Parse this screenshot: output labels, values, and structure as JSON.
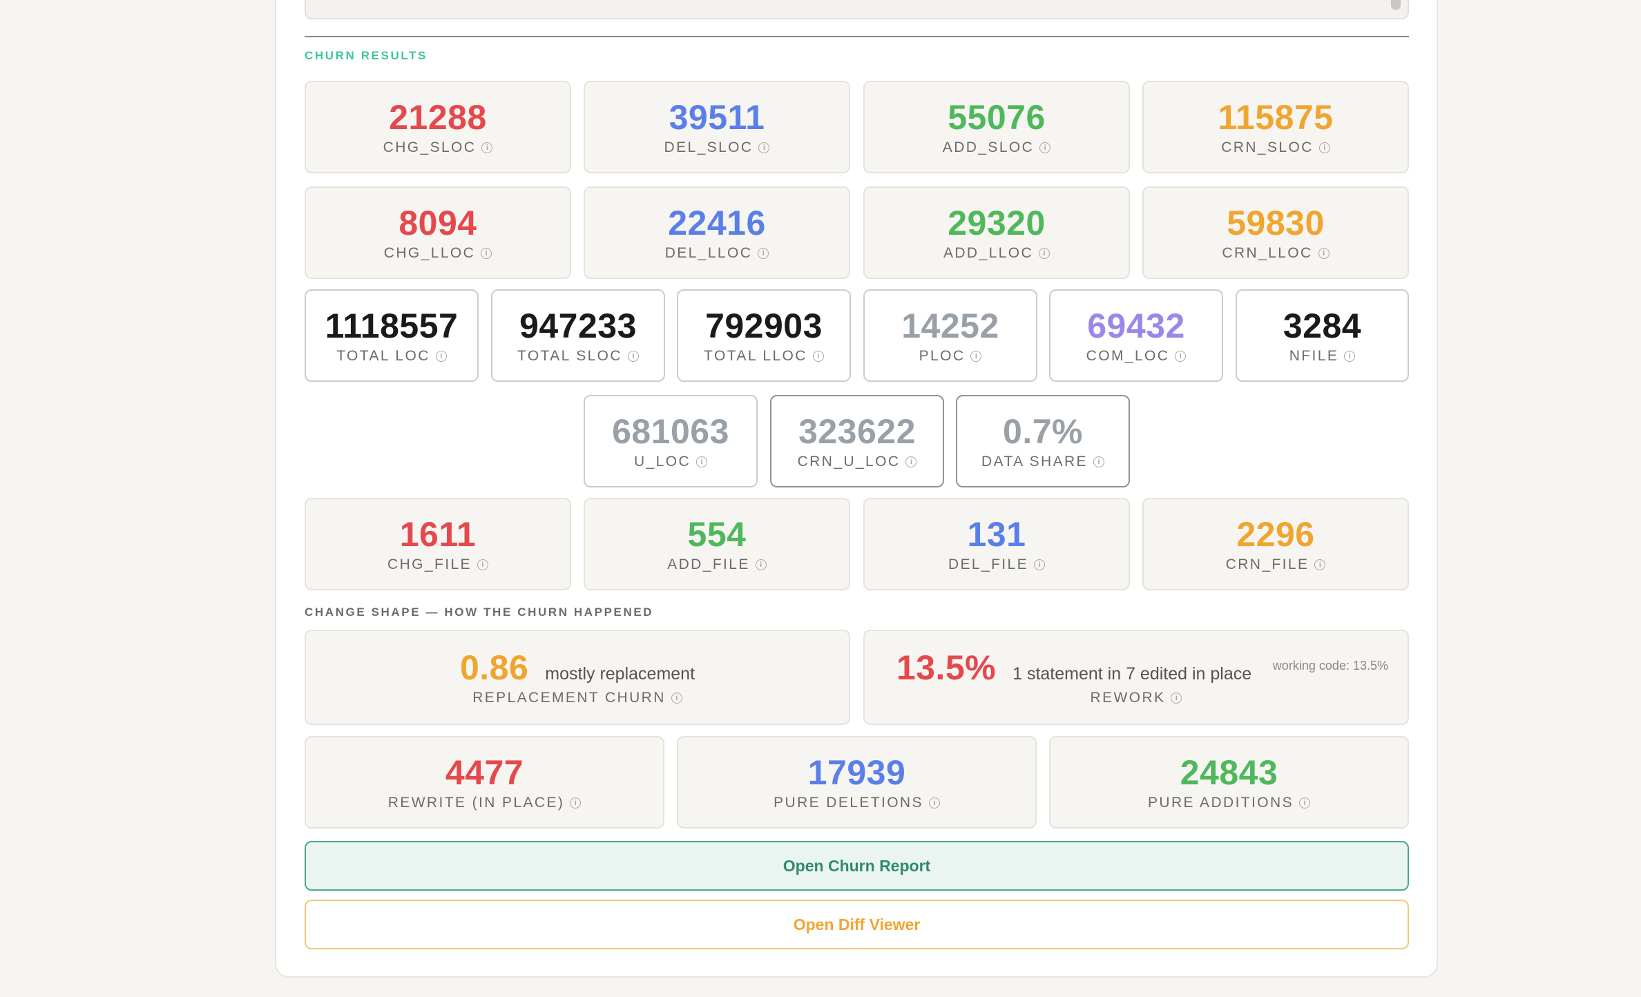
{
  "colors": {
    "red": "#e5484d",
    "blue": "#5b7fe8",
    "green": "#4fb85c",
    "orange": "#f0a531",
    "black": "#1a1a1a",
    "gray": "#9aa0a8",
    "purple": "#9b87ea",
    "teal_label": "#3ec4a0",
    "teal_button": "#2f8a6e"
  },
  "churn_results": {
    "title": "CHURN RESULTS",
    "sloc": [
      {
        "value": "21288",
        "label": "CHG_SLOC"
      },
      {
        "value": "39511",
        "label": "DEL_SLOC"
      },
      {
        "value": "55076",
        "label": "ADD_SLOC"
      },
      {
        "value": "115875",
        "label": "CRN_SLOC"
      }
    ],
    "lloc": [
      {
        "value": "8094",
        "label": "CHG_LLOC"
      },
      {
        "value": "22416",
        "label": "DEL_LLOC"
      },
      {
        "value": "29320",
        "label": "ADD_LLOC"
      },
      {
        "value": "59830",
        "label": "CRN_LLOC"
      }
    ],
    "totals": [
      {
        "value": "1118557",
        "label": "TOTAL LOC"
      },
      {
        "value": "947233",
        "label": "TOTAL SLOC"
      },
      {
        "value": "792903",
        "label": "TOTAL LLOC"
      },
      {
        "value": "14252",
        "label": "PLOC"
      },
      {
        "value": "69432",
        "label": "COM_LOC"
      },
      {
        "value": "3284",
        "label": "NFILE"
      }
    ],
    "unique": [
      {
        "value": "681063",
        "label": "U_LOC"
      },
      {
        "value": "323622",
        "label": "CRN_U_LOC"
      },
      {
        "value": "0.7%",
        "label": "DATA SHARE"
      }
    ],
    "files": [
      {
        "value": "1611",
        "label": "CHG_FILE"
      },
      {
        "value": "554",
        "label": "ADD_FILE"
      },
      {
        "value": "131",
        "label": "DEL_FILE"
      },
      {
        "value": "2296",
        "label": "CRN_FILE"
      }
    ]
  },
  "change_shape": {
    "title": "CHANGE SHAPE — HOW THE CHURN HAPPENED",
    "replacement": {
      "value": "0.86",
      "desc": "mostly replacement",
      "label": "REPLACEMENT CHURN"
    },
    "rework": {
      "value": "13.5%",
      "desc": "1 statement in 7 edited in place",
      "note": "working code: 13.5%",
      "label": "REWORK"
    },
    "breakdown": [
      {
        "value": "4477",
        "label": "REWRITE (IN PLACE)"
      },
      {
        "value": "17939",
        "label": "PURE DELETIONS"
      },
      {
        "value": "24843",
        "label": "PURE ADDITIONS"
      }
    ]
  },
  "buttons": {
    "churn_report": "Open Churn Report",
    "diff_viewer": "Open Diff Viewer"
  },
  "icons": {
    "info": "info-circle-icon"
  }
}
